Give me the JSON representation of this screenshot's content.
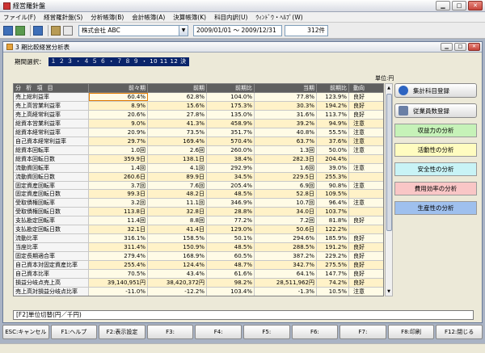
{
  "app": {
    "title": "経営羅針盤"
  },
  "menu": [
    "ファイル(F)",
    "経営羅針盤(S)",
    "分析帳簿(B)",
    "会計帳簿(A)",
    "決算帳簿(K)",
    "科目内訳(U)",
    "ｳｨﾝﾄﾞｳ・ﾍﾙﾌﾟ(W)"
  ],
  "toolbar": {
    "company": "株式会社 ABC",
    "date_range": "2009/01/01 〜 2009/12/31",
    "count": "312件"
  },
  "child": {
    "title": "3 期比較経営分析表"
  },
  "period": {
    "label": "期間選択：",
    "value": "１ ２ ３ ・ ４ ５ ６ ・ ７ ８ ９ ・ 10 11 12 決"
  },
  "unit_label": "単位:円",
  "table": {
    "headers": {
      "item": "分 析 項 目",
      "prev": "前々期",
      "cur": "前期",
      "ratio1": "前期比",
      "cur2": "当期",
      "ratio2": "前期比",
      "trend": "動向"
    },
    "rows": [
      {
        "item": "売上総利益率",
        "prev": "60.4%",
        "cur": "62.8%",
        "ratio1": "104.0%",
        "cur2": "77.8%",
        "ratio2": "123.9%",
        "trend": "良好"
      },
      {
        "item": "売上高営業利益率",
        "prev": "8.9%",
        "cur": "15.6%",
        "ratio1": "175.3%",
        "cur2": "30.3%",
        "ratio2": "194.2%",
        "trend": "良好"
      },
      {
        "item": "売上高経常利益率",
        "prev": "20.6%",
        "cur": "27.8%",
        "ratio1": "135.0%",
        "cur2": "31.6%",
        "ratio2": "113.7%",
        "trend": "良好"
      },
      {
        "item": "総資本営業利益率",
        "prev": "9.0%",
        "cur": "41.3%",
        "ratio1": "458.9%",
        "cur2": "39.2%",
        "ratio2": "94.9%",
        "trend": "注意"
      },
      {
        "item": "総資本経常利益率",
        "prev": "20.9%",
        "cur": "73.5%",
        "ratio1": "351.7%",
        "cur2": "40.8%",
        "ratio2": "55.5%",
        "trend": "注意"
      },
      {
        "item": "自己資本経常利益率",
        "prev": "29.7%",
        "cur": "169.4%",
        "ratio1": "570.4%",
        "cur2": "63.7%",
        "ratio2": "37.6%",
        "trend": "注意"
      },
      {
        "item": "総資本回転率",
        "prev": "1.0回",
        "cur": "2.6回",
        "ratio1": "260.0%",
        "cur2": "1.3回",
        "ratio2": "50.0%",
        "trend": "注意"
      },
      {
        "item": "総資本回転日数",
        "prev": "359.9日",
        "cur": "138.1日",
        "ratio1": "38.4%",
        "cur2": "282.3日",
        "ratio2": "204.4%",
        "trend": ""
      },
      {
        "item": "流動資回転率",
        "prev": "1.4回",
        "cur": "4.1回",
        "ratio1": "292.9%",
        "cur2": "1.6回",
        "ratio2": "39.0%",
        "trend": "注意"
      },
      {
        "item": "流動資回転日数",
        "prev": "260.6日",
        "cur": "89.9日",
        "ratio1": "34.5%",
        "cur2": "229.5日",
        "ratio2": "255.3%",
        "trend": ""
      },
      {
        "item": "固定資産回転率",
        "prev": "3.7回",
        "cur": "7.6回",
        "ratio1": "205.4%",
        "cur2": "6.9回",
        "ratio2": "90.8%",
        "trend": "注意"
      },
      {
        "item": "固定資産回転日数",
        "prev": "99.3日",
        "cur": "48.2日",
        "ratio1": "48.5%",
        "cur2": "52.8日",
        "ratio2": "109.5%",
        "trend": ""
      },
      {
        "item": "受取債権回転率",
        "prev": "3.2回",
        "cur": "11.1回",
        "ratio1": "346.9%",
        "cur2": "10.7回",
        "ratio2": "96.4%",
        "trend": "注意"
      },
      {
        "item": "受取債権回転日数",
        "prev": "113.8日",
        "cur": "32.8日",
        "ratio1": "28.8%",
        "cur2": "34.0日",
        "ratio2": "103.7%",
        "trend": ""
      },
      {
        "item": "支払勘定回転率",
        "prev": "11.4回",
        "cur": "8.8回",
        "ratio1": "77.2%",
        "cur2": "7.2回",
        "ratio2": "81.8%",
        "trend": "良好"
      },
      {
        "item": "支払勘定回転日数",
        "prev": "32.1日",
        "cur": "41.4日",
        "ratio1": "129.0%",
        "cur2": "50.6日",
        "ratio2": "122.2%",
        "trend": ""
      },
      {
        "item": "流動比率",
        "prev": "316.1%",
        "cur": "158.5%",
        "ratio1": "50.1%",
        "cur2": "294.6%",
        "ratio2": "185.9%",
        "trend": "良好"
      },
      {
        "item": "当座比率",
        "prev": "311.4%",
        "cur": "150.9%",
        "ratio1": "48.5%",
        "cur2": "288.5%",
        "ratio2": "191.2%",
        "trend": "良好"
      },
      {
        "item": "固定長期適合率",
        "prev": "279.4%",
        "cur": "168.9%",
        "ratio1": "60.5%",
        "cur2": "387.2%",
        "ratio2": "229.2%",
        "trend": "良好"
      },
      {
        "item": "自己資本対固定資産比率",
        "prev": "255.4%",
        "cur": "124.4%",
        "ratio1": "48.7%",
        "cur2": "342.7%",
        "ratio2": "275.5%",
        "trend": "良好"
      },
      {
        "item": "自己資本比率",
        "prev": "70.5%",
        "cur": "43.4%",
        "ratio1": "61.6%",
        "cur2": "64.1%",
        "ratio2": "147.7%",
        "trend": "良好"
      },
      {
        "item": "損益分岐点売上高",
        "prev": "39,140,951円",
        "cur": "38,420,372円",
        "ratio1": "98.2%",
        "cur2": "28,511,962円",
        "ratio2": "74.2%",
        "trend": "良好"
      },
      {
        "item": "売上高対損益分岐点比率",
        "prev": "-11.0%",
        "cur": "-12.2%",
        "ratio1": "103.4%",
        "cur2": "-1.3%",
        "ratio2": "10.5%",
        "trend": "注意"
      }
    ]
  },
  "side": {
    "buttons": [
      "集計科目登録",
      "従業員数登録"
    ],
    "analysis": [
      {
        "label": "収益力の分析",
        "color": "#c6f2b8"
      },
      {
        "label": "活動性の分析",
        "color": "#fffcc0"
      },
      {
        "label": "安全性の分析",
        "color": "#c8f3f6"
      },
      {
        "label": "費用効率の分析",
        "color": "#f9c6c6"
      },
      {
        "label": "生産性の分析",
        "color": "#9fc0ee"
      }
    ]
  },
  "f2_toggle": "[F2]単位切替(円／千円)",
  "fkeys": [
    "ESC:キャンセル",
    "F1:ヘルプ",
    "F2:表示設定",
    "F3:",
    "F4:",
    "F5:",
    "F6:",
    "F7:",
    "F8:印刷",
    "F12:閉じる"
  ]
}
